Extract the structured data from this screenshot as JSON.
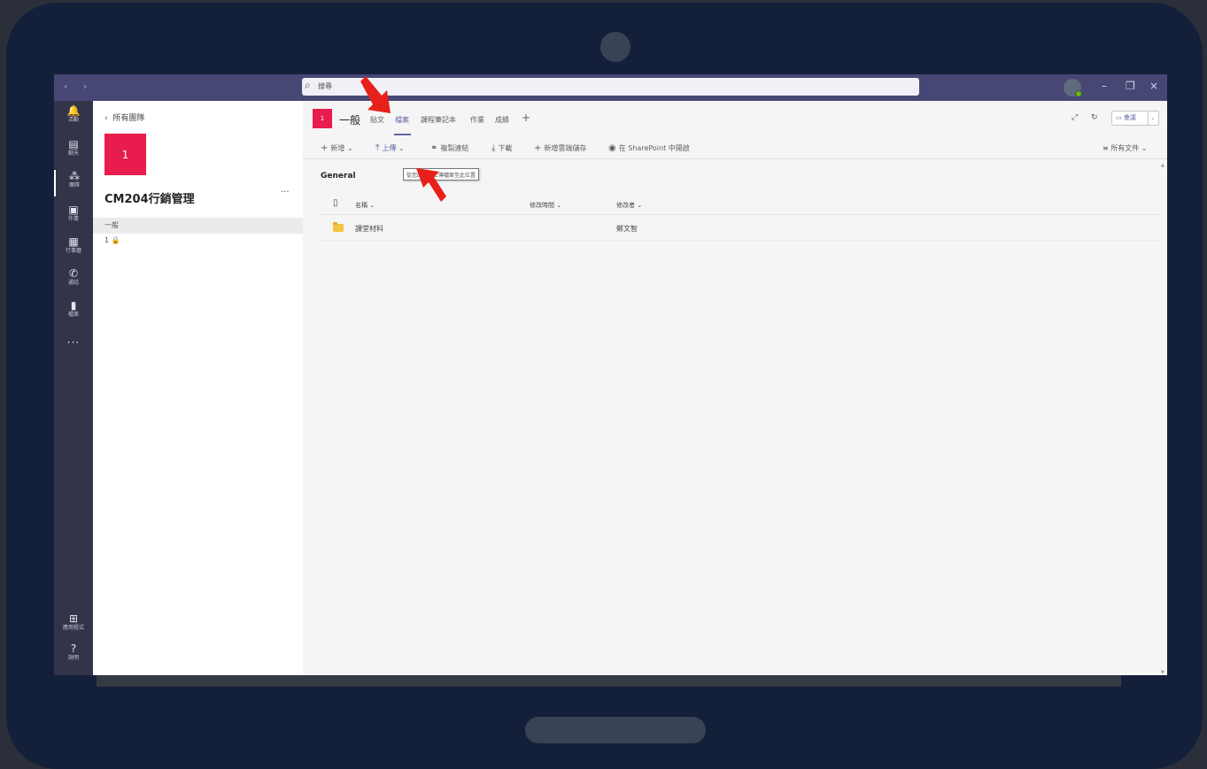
{
  "titlebar": {
    "nav_arrows": "‹ ›",
    "search_placeholder": "搜尋",
    "window_controls": [
      "–",
      "❐",
      "×"
    ]
  },
  "rail": {
    "items": [
      {
        "label": "活動",
        "icon": "bell-icon",
        "glyph": "🔔"
      },
      {
        "label": "聊天",
        "icon": "chat-icon",
        "glyph": "▤"
      },
      {
        "label": "團隊",
        "icon": "teams-icon",
        "glyph": "⁂"
      },
      {
        "label": "作業",
        "icon": "assignments-icon",
        "glyph": "▣"
      },
      {
        "label": "行事曆",
        "icon": "calendar-icon",
        "glyph": "▦"
      },
      {
        "label": "通話",
        "icon": "phone-icon",
        "glyph": "✆"
      },
      {
        "label": "檔案",
        "icon": "files-icon",
        "glyph": "▮"
      }
    ],
    "more": "···",
    "apps_label": "應用程式",
    "help_label": "說明"
  },
  "team_panel": {
    "back_label": "所有團隊",
    "team_tile": "1",
    "team_name": "CM204行銷管理",
    "more": "···",
    "channels": [
      "一般",
      "1 🔒"
    ]
  },
  "channel_header": {
    "tile": "1",
    "name": "一般",
    "tabs": [
      "貼文",
      "檔案",
      "課程筆記本",
      "作業",
      "成績"
    ],
    "active_tab": "檔案",
    "add_tab": "+",
    "meet_label": "會議"
  },
  "toolbar": {
    "new": "新增",
    "upload": "上傳",
    "copy_link": "複製連結",
    "download": "下載",
    "add_cloud": "新增雲端儲存",
    "open_sharepoint": "在 SharePoint 中開啟",
    "all_docs": "所有文件"
  },
  "files": {
    "breadcrumb": "General",
    "tooltip": "從您的裝置上傳檔案至此位置",
    "columns": {
      "name": "名稱",
      "modified": "修改時間",
      "modified_by": "修改者"
    },
    "rows": [
      {
        "name": "課堂材料",
        "modified": "",
        "modified_by": "鄭文智"
      }
    ]
  },
  "colors": {
    "accent": "#6264a7",
    "titlebar": "#464775",
    "rail": "#33344a",
    "team_tile": "#e81d4d",
    "annotation_arrow": "#e8201a"
  }
}
